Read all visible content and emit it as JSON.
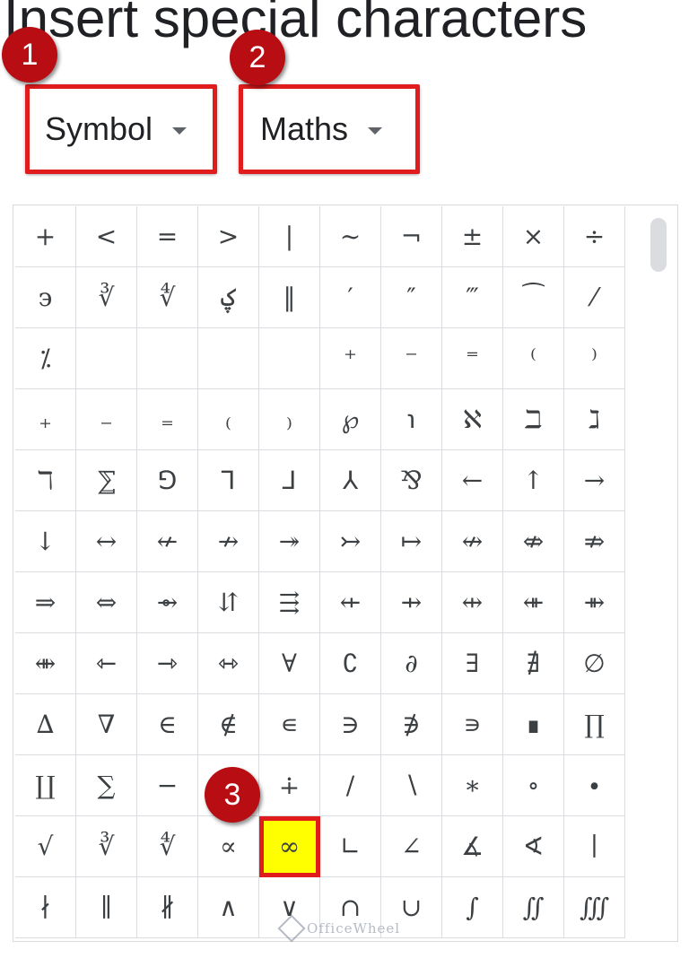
{
  "title": "Insert special characters",
  "dropdowns": {
    "category": {
      "label": "Symbol"
    },
    "subcategory": {
      "label": "Maths"
    }
  },
  "markers": [
    "1",
    "2",
    "3"
  ],
  "grid": {
    "rows": [
      [
        "+",
        "<",
        "=",
        ">",
        "|",
        "~",
        "¬",
        "±",
        "×",
        "÷"
      ],
      [
        "϶",
        "∛",
        "∜",
        "ؼ",
        "‖",
        "′",
        "″",
        "‴",
        "⁀",
        "⁄"
      ],
      [
        "⁒",
        "",
        "",
        "",
        "",
        "⁺",
        "⁻",
        "⁼",
        "⁽",
        "⁾"
      ],
      [
        "₊",
        "₋",
        "₌",
        "₍",
        "₎",
        "℘",
        "℩",
        "ℵ",
        "ℶ",
        "ℷ"
      ],
      [
        "ℸ",
        "⅀",
        "⅁",
        "⅂",
        "⅃",
        "⅄",
        "⅋",
        "←",
        "↑",
        "→"
      ],
      [
        "↓",
        "↔",
        "↚",
        "↛",
        "↠",
        "↣",
        "↦",
        "↮",
        "⇎",
        "⇏"
      ],
      [
        "⇒",
        "⇔",
        "⇴",
        "⇵",
        "⇶",
        "⇷",
        "⇸",
        "⇹",
        "⇺",
        "⇻"
      ],
      [
        "⇼",
        "⇽",
        "⇾",
        "⇿",
        "∀",
        "∁",
        "∂",
        "∃",
        "∄",
        "∅"
      ],
      [
        "∆",
        "∇",
        "∈",
        "∉",
        "∊",
        "∋",
        "∌",
        "∍",
        "∎",
        "∏"
      ],
      [
        "∐",
        "∑",
        "−",
        "∓",
        "∔",
        "∕",
        "∖",
        "∗",
        "∘",
        "∙"
      ],
      [
        "√",
        "∛",
        "∜",
        "∝",
        "∞",
        "∟",
        "∠",
        "∡",
        "∢",
        "∣"
      ],
      [
        "∤",
        "∥",
        "∦",
        "∧",
        "∨",
        "∩",
        "∪",
        "∫",
        "∬",
        "∭"
      ]
    ],
    "highlighted": "∞"
  },
  "watermark": "OfficeWheel",
  "colors": {
    "highlight_border": "#e01c1c",
    "highlight_fill": "#ffff00",
    "marker": "#b80d12"
  }
}
